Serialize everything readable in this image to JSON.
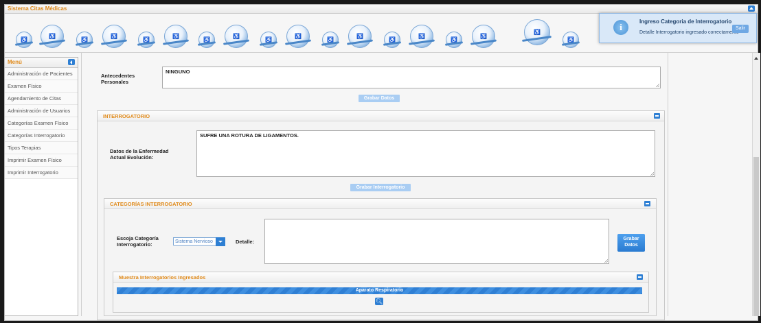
{
  "app": {
    "title": "Sistema Citas Médicas"
  },
  "toast": {
    "title": "Ingreso Categoria de Interrogatorio",
    "message": "Detalle Interrogatorio ingresado correctamente",
    "icon": "info-icon",
    "button": "Salir"
  },
  "menu": {
    "title": "Menú",
    "items": [
      {
        "label": "Administración de Pacientes"
      },
      {
        "label": "Examen Físico"
      },
      {
        "label": "Agendamiento de Citas"
      },
      {
        "label": "Administración de Usuarios"
      },
      {
        "label": "Categorías Examen Físico"
      },
      {
        "label": "Categorías Interrogatorio"
      },
      {
        "label": "Tipos Terapias"
      },
      {
        "label": "Imprimir Examen Físico"
      },
      {
        "label": "Imprimir Interrogatorio"
      }
    ]
  },
  "antecedentes": {
    "label": "Antecedentes Personales",
    "value": "NINGUNO",
    "save_button": "Grabar Datos"
  },
  "interrogatorio": {
    "title": "INTERROGATORIO",
    "field_label": "Datos de la Enfermedad Actual Evolución:",
    "field_value": "SUFRE UNA ROTURA DE LIGAMENTOS.",
    "save_button": "Grabar Interrogatorio"
  },
  "categorias": {
    "title": "CATEGORÍAS INTERROGATORIO",
    "select_label": "Escoja Categoría Interrogatorio:",
    "select_value": "Sistema Nervioso",
    "detail_label": "Detalle:",
    "detail_value": "",
    "save_button": "Grabar Datos"
  },
  "muestra": {
    "title": "Muestra Interrogatorios Ingresados",
    "group": "Aparato Respiratorio",
    "search_icon": "search-icon"
  },
  "colors": {
    "accent": "#e08a1a",
    "primary": "#2e7fd3"
  }
}
